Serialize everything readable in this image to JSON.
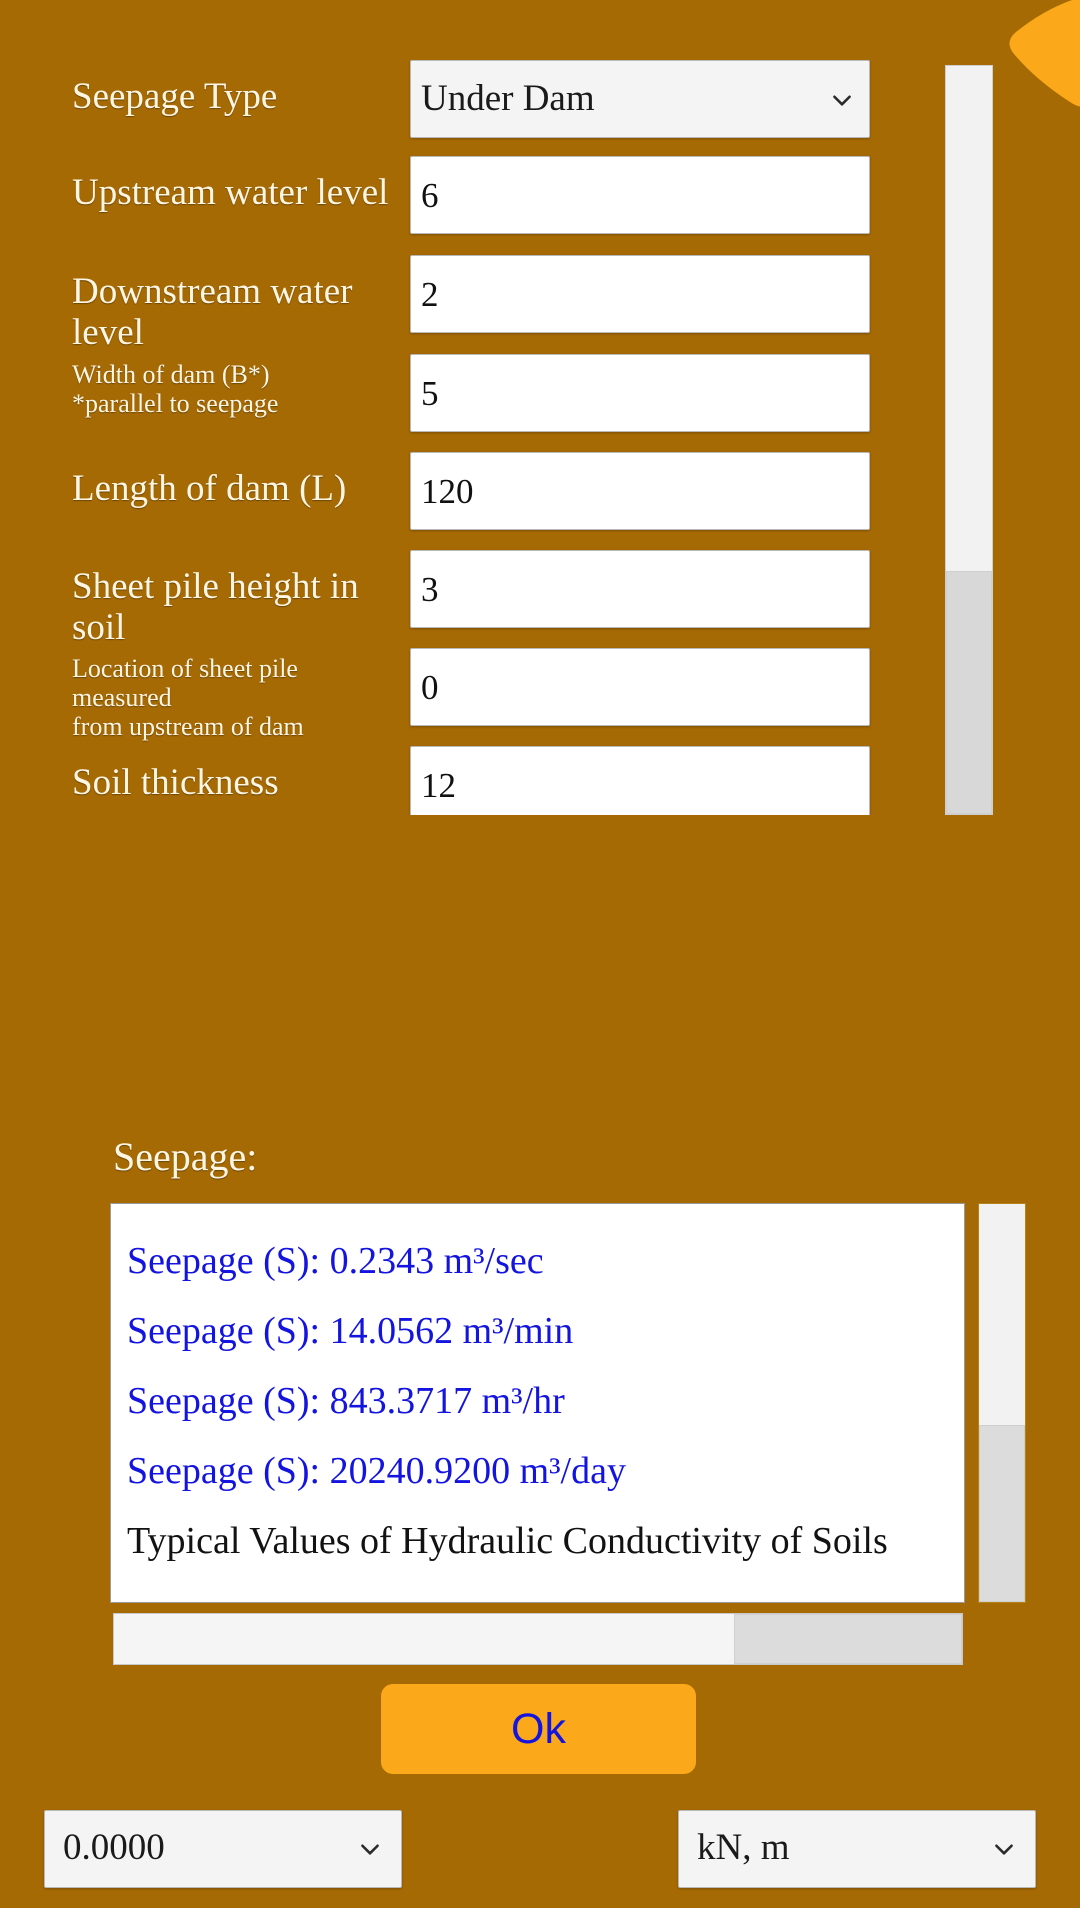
{
  "theme": {
    "background": "#a66a05",
    "accent_orange": "#fba91a",
    "label_text": "#fdf6e3",
    "result_value_text": "#1414e0"
  },
  "form": {
    "rows": [
      {
        "label": "Seepage Type",
        "value": "Under Dam",
        "control": "select",
        "size": "big"
      },
      {
        "label": "Upstream water level",
        "value": "6",
        "control": "text",
        "size": "big"
      },
      {
        "label": "Downstream water level",
        "value": "2",
        "control": "text",
        "size": "big"
      },
      {
        "label": "Width of dam (B*)\n*parallel to seepage",
        "value": "5",
        "control": "text",
        "size": "small"
      },
      {
        "label": "Length of dam (L)",
        "value": "120",
        "control": "text",
        "size": "big"
      },
      {
        "label": "Sheet pile height in soil",
        "value": "3",
        "control": "text",
        "size": "big"
      },
      {
        "label": "Location of sheet pile measured\nfrom upstream of dam",
        "value": "0",
        "control": "text",
        "size": "small"
      },
      {
        "label": "Soil thickness",
        "value": "12",
        "control": "text",
        "size": "big"
      }
    ]
  },
  "results": {
    "title": "Seepage:",
    "lines": [
      {
        "text": "Seepage (S): 0.2343 m³/sec",
        "kind": "value"
      },
      {
        "text": "Seepage (S): 14.0562 m³/min",
        "kind": "value"
      },
      {
        "text": "Seepage (S): 843.3717 m³/hr",
        "kind": "value"
      },
      {
        "text": "Seepage (S): 20240.9200 m³/day",
        "kind": "value"
      },
      {
        "text": "Typical Values of Hydraulic Conductivity of Soils",
        "kind": "note"
      }
    ]
  },
  "actions": {
    "ok_label": "Ok"
  },
  "footer": {
    "precision": "0.0000",
    "units": "kN, m"
  },
  "icons": {
    "chevron_down": "chevron-down-icon",
    "corner_wedge": "corner-wedge-icon"
  }
}
